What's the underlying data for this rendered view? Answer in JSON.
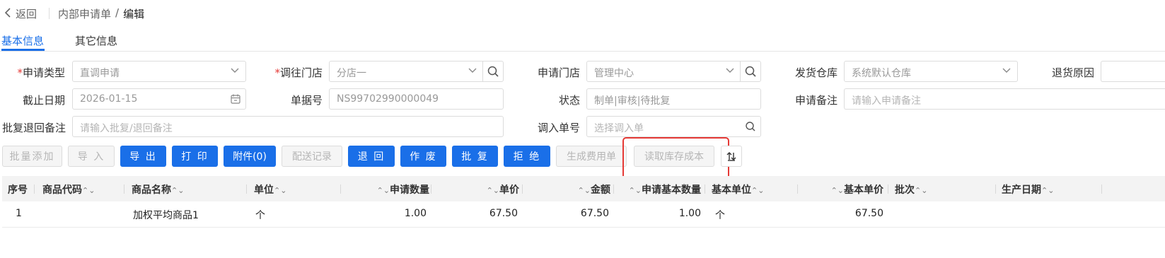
{
  "header": {
    "back_label": "返回",
    "breadcrumb_parent": "内部申请单",
    "breadcrumb_sep": "/",
    "breadcrumb_current": "编辑"
  },
  "tabs": [
    {
      "label": "基本信息",
      "active": true
    },
    {
      "label": "其它信息",
      "active": false
    }
  ],
  "form": {
    "apply_type": {
      "required": "*",
      "label": "申请类型",
      "value": "直调申请"
    },
    "transfer_store": {
      "required": "*",
      "label": "调往门店",
      "value": "分店一"
    },
    "apply_store": {
      "label": "申请门店",
      "value": "管理中心"
    },
    "ship_warehouse": {
      "label": "发货仓库",
      "value": "系统默认仓库"
    },
    "return_reason": {
      "label": "退货原因"
    },
    "deadline": {
      "label": "截止日期",
      "value": "2026-01-15"
    },
    "doc_no": {
      "label": "单据号",
      "value": "NS99702990000049"
    },
    "status": {
      "label": "状态",
      "value": "制单|审核|待批复"
    },
    "apply_remark": {
      "label": "申请备注",
      "placeholder": "请输入申请备注"
    },
    "approve_remark": {
      "label": "批复退回备注",
      "placeholder": "请输入批复/退回备注"
    },
    "transfer_in_no": {
      "label": "调入单号",
      "placeholder": "选择调入单"
    }
  },
  "toolbar": {
    "batch_add": "批量添加",
    "import": "导 入",
    "export": "导 出",
    "print": "打 印",
    "attachment": "附件(0)",
    "delivery_record": "配送记录",
    "return": "退 回",
    "void": "作 废",
    "approve": "批 复",
    "reject": "拒 绝",
    "gen_expense": "生成费用单",
    "read_cost": "读取库存成本"
  },
  "table": {
    "sort_glyph": "⌃⌄",
    "columns": [
      "序号",
      "商品代码",
      "商品名称",
      "单位",
      "申请数量",
      "单价",
      "金额",
      "申请基本数量",
      "基本单位",
      "基本单价",
      "批次",
      "生产日期"
    ],
    "rows": [
      {
        "no": "1",
        "code": "",
        "name": "加权平均商品1",
        "unit": "个",
        "qty": "1.00",
        "price": "67.50",
        "amount": "67.50",
        "base_qty": "1.00",
        "base_unit": "个",
        "base_price": "67.50",
        "batch": "",
        "mfg_date": ""
      }
    ]
  },
  "colors": {
    "primary": "#1a6fe8",
    "required": "#e53935",
    "highlight": "#e53935"
  }
}
